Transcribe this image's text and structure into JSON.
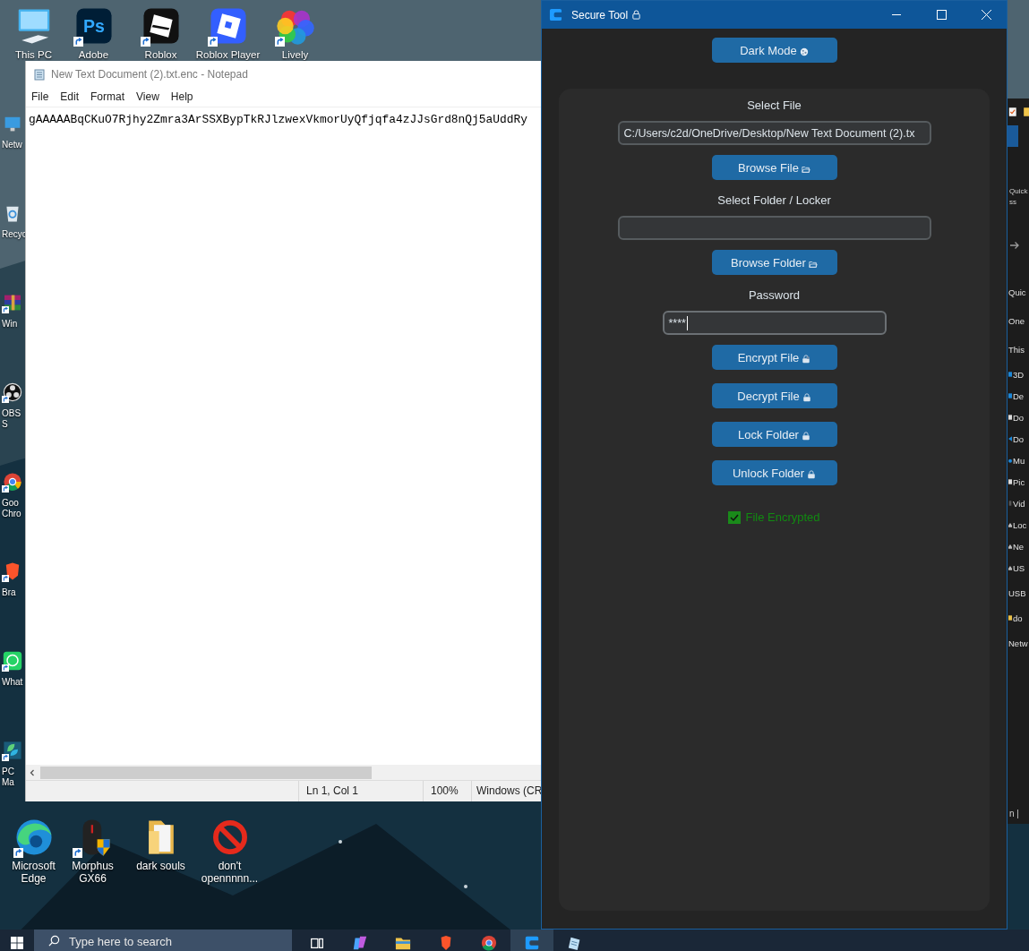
{
  "desktop_top_icons": [
    {
      "label": "This PC",
      "kind": "computer",
      "shortcut": false
    },
    {
      "label": "Adobe",
      "kind": "photoshop",
      "glyph": "Ps",
      "shortcut": true
    },
    {
      "label": "Roblox",
      "kind": "roblox",
      "shortcut": true
    },
    {
      "label": "Roblox Player",
      "kind": "roblox_player",
      "shortcut": true
    },
    {
      "label": "Lively",
      "kind": "lively",
      "shortcut": true
    }
  ],
  "desktop_side_icons": [
    {
      "label": "Netw",
      "kind": "network",
      "shortcut": false
    },
    {
      "label": "Recyc",
      "kind": "recycle",
      "shortcut": false
    },
    {
      "label": "Win",
      "kind": "winrar",
      "shortcut": true
    },
    {
      "label": "OBS S",
      "kind": "obs",
      "shortcut": true
    },
    {
      "label": "Goo Chro",
      "kind": "chrome",
      "shortcut": true
    },
    {
      "label": "Bra",
      "kind": "brave",
      "shortcut": true
    },
    {
      "label": "What",
      "kind": "whatsapp",
      "shortcut": true
    },
    {
      "label": "PC Ma",
      "kind": "pcmanager",
      "shortcut": true
    }
  ],
  "desktop_bottom_icons": [
    {
      "label": "Microsoft Edge",
      "kind": "edge",
      "shortcut": true
    },
    {
      "label": "Morphus GX66",
      "kind": "mouse",
      "shortcut": true
    },
    {
      "label": "dark souls",
      "kind": "folder",
      "shortcut": false
    },
    {
      "label": "don't opennnnn...",
      "kind": "forbidden",
      "shortcut": false
    }
  ],
  "notepad": {
    "title": "New Text Document (2).txt.enc - Notepad",
    "menu": [
      "File",
      "Edit",
      "Format",
      "View",
      "Help"
    ],
    "content": "gAAAAABqCKuO7Rjhy2Zmra3ArSSXBypTkRJlzwexVkmorUyQfjqfa4zJJsGrd8nQj5aUddRy",
    "status": [
      "Ln 1, Col 1",
      "100%",
      "Windows (CR"
    ]
  },
  "secure_tool": {
    "title": "Secure Tool",
    "theme_button": "Dark Mode",
    "controls": [
      {
        "kind": "label",
        "text": "Select File"
      },
      {
        "kind": "field",
        "value": "C:/Users/c2d/OneDrive/Desktop/New Text Document (2).tx",
        "focused": false
      },
      {
        "kind": "browse_button",
        "text": "Browse File"
      },
      {
        "kind": "label",
        "text": "Select Folder / Locker"
      },
      {
        "kind": "field",
        "focused": false
      },
      {
        "kind": "browse_button",
        "text": "Browse Folder"
      },
      {
        "kind": "label",
        "text": "Password"
      },
      {
        "kind": "password_field",
        "value": "****",
        "focused": true
      },
      {
        "kind": "key_button",
        "text": "Encrypt File"
      },
      {
        "kind": "lock_button",
        "text": "Decrypt File"
      },
      {
        "kind": "lock_button",
        "text": "Lock Folder"
      },
      {
        "kind": "lock_button",
        "text": "Unlock Folder"
      },
      {
        "kind": "status",
        "text": "File Encrypted",
        "ok": true
      }
    ]
  },
  "explorer": {
    "ribbon_texts": [
      "Quick",
      "ss"
    ],
    "nav": [
      {
        "text": "Quic",
        "kind": "heading"
      },
      {
        "text": "One",
        "kind": "heading"
      },
      {
        "text": "This",
        "kind": "heading"
      },
      {
        "text": "3D",
        "kind": "folder"
      },
      {
        "text": "De",
        "kind": "folder"
      },
      {
        "text": "Do",
        "kind": "file"
      },
      {
        "text": "Do",
        "kind": "download"
      },
      {
        "text": "Mu",
        "kind": "music"
      },
      {
        "text": "Pic",
        "kind": "file"
      },
      {
        "text": "Vid",
        "kind": "video"
      },
      {
        "text": "Loc",
        "kind": "drive"
      },
      {
        "text": "Ne",
        "kind": "drive"
      },
      {
        "text": "US",
        "kind": "drive"
      },
      {
        "text": "USB",
        "kind": "heading"
      },
      {
        "text": "do",
        "kind": "folder_yellow"
      },
      {
        "text": "Netw",
        "kind": "heading"
      }
    ],
    "status_text": "n |"
  },
  "taskbar": {
    "search_placeholder": "Type here to search",
    "apps": [
      {
        "kind": "taskview",
        "selected": false
      },
      {
        "kind": "copilot",
        "selected": false
      },
      {
        "kind": "explorer",
        "selected": false
      },
      {
        "kind": "brave",
        "selected": false
      },
      {
        "kind": "chrome",
        "selected": false
      },
      {
        "kind": "securetool",
        "selected": true
      },
      {
        "kind": "notepad",
        "selected": false
      }
    ]
  }
}
